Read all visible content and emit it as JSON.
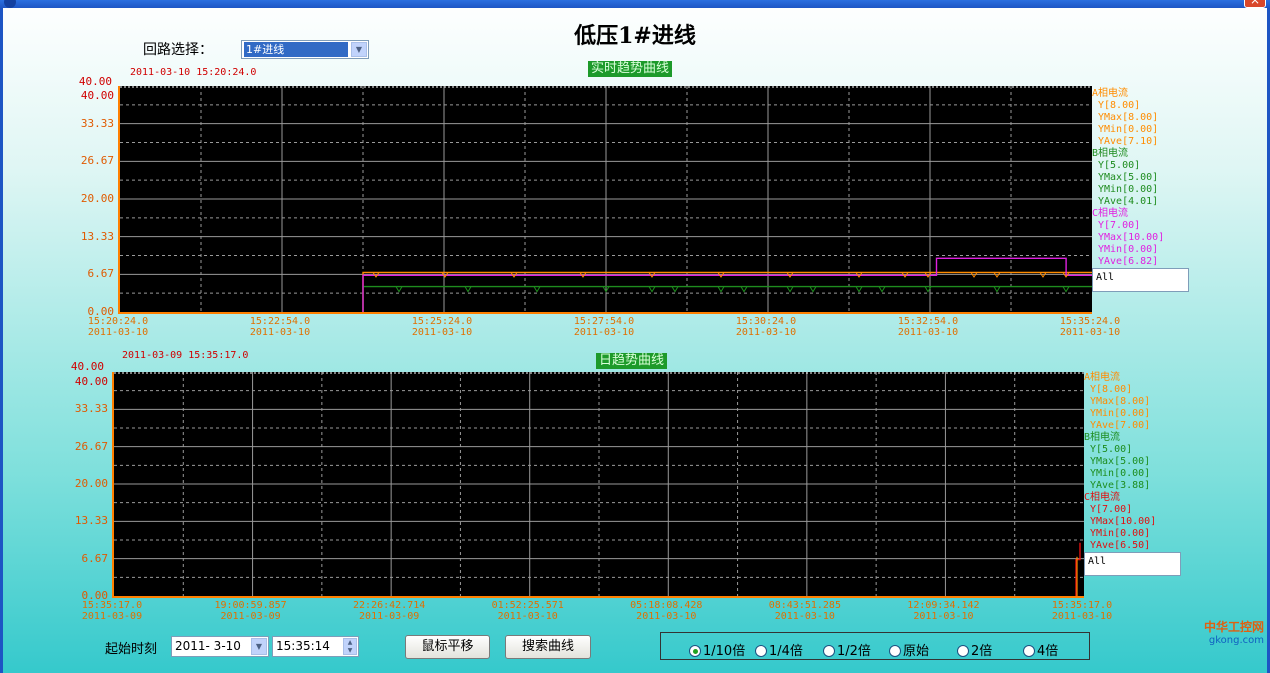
{
  "window": {
    "title_icon": "app-icon",
    "close": "×"
  },
  "page_title": "低压1#进线",
  "loop": {
    "label": "回路选择：",
    "selected": "1#进线"
  },
  "chart1": {
    "title": "实时趋势曲线",
    "timestamp": "2011-03-10 15:20:24.0",
    "y_top": "40.00",
    "y_ticks": [
      "40.00",
      "33.33",
      "26.67",
      "20.00",
      "13.33",
      "6.67",
      "0.00"
    ],
    "x_ticks": [
      {
        "t": "15:20:24.0",
        "d": "2011-03-10"
      },
      {
        "t": "15:22:54.0",
        "d": "2011-03-10"
      },
      {
        "t": "15:25:24.0",
        "d": "2011-03-10"
      },
      {
        "t": "15:27:54.0",
        "d": "2011-03-10"
      },
      {
        "t": "15:30:24.0",
        "d": "2011-03-10"
      },
      {
        "t": "15:32:54.0",
        "d": "2011-03-10"
      },
      {
        "t": "15:35:24.0",
        "d": "2011-03-10"
      }
    ],
    "legend": [
      {
        "name": "A相电流",
        "color": "#ff8c00",
        "lines": [
          "Y[8.00]",
          "YMax[8.00]",
          "YMin[0.00]",
          "YAve[7.10]"
        ]
      },
      {
        "name": "B相电流",
        "color": "#1e8c1e",
        "lines": [
          "Y[5.00]",
          "YMax[5.00]",
          "YMin[0.00]",
          "YAve[4.01]"
        ]
      },
      {
        "name": "C相电流",
        "color": "#e020e0",
        "lines": [
          "Y[7.00]",
          "YMax[10.00]",
          "YMin[0.00]",
          "YAve[6.82]"
        ]
      }
    ],
    "all_label": "All"
  },
  "chart2": {
    "title": "日趋势曲线",
    "timestamp": "2011-03-09 15:35:17.0",
    "y_top": "40.00",
    "y_ticks": [
      "40.00",
      "33.33",
      "26.67",
      "20.00",
      "13.33",
      "6.67",
      "0.00"
    ],
    "x_ticks": [
      {
        "t": "15:35:17.0",
        "d": "2011-03-09"
      },
      {
        "t": "19:00:59.857",
        "d": "2011-03-09"
      },
      {
        "t": "22:26:42.714",
        "d": "2011-03-09"
      },
      {
        "t": "01:52:25.571",
        "d": "2011-03-10"
      },
      {
        "t": "05:18:08.428",
        "d": "2011-03-10"
      },
      {
        "t": "08:43:51.285",
        "d": "2011-03-10"
      },
      {
        "t": "12:09:34.142",
        "d": "2011-03-10"
      },
      {
        "t": "15:35:17.0",
        "d": "2011-03-10"
      }
    ],
    "legend": [
      {
        "name": "A相电流",
        "color": "#ff8c00",
        "lines": [
          "Y[8.00]",
          "YMax[8.00]",
          "YMin[0.00]",
          "YAve[7.00]"
        ]
      },
      {
        "name": "B相电流",
        "color": "#1e8c1e",
        "lines": [
          "Y[5.00]",
          "YMax[5.00]",
          "YMin[0.00]",
          "YAve[3.88]"
        ]
      },
      {
        "name": "C相电流",
        "color": "#e01010",
        "lines": [
          "Y[7.00]",
          "YMax[10.00]",
          "YMin[0.00]",
          "YAve[6.50]"
        ]
      }
    ],
    "all_label": "All"
  },
  "controls": {
    "start_label": "起始时刻",
    "date_value": "2011- 3-10",
    "time_value": "15:35:14",
    "pan_button": "鼠标平移",
    "search_button": "搜索曲线",
    "zoom_options": [
      "1/10倍",
      "1/4倍",
      "1/2倍",
      "原始",
      "2倍",
      "4倍"
    ],
    "zoom_selected": "1/10倍"
  },
  "watermark": {
    "text": "中华工控网",
    "sub": "gkong.com"
  },
  "chart_data": [
    {
      "type": "line",
      "title": "实时趋势曲线",
      "ylim": [
        0,
        40
      ],
      "xlim": [
        "15:20:24.0",
        "15:35:24.0"
      ],
      "series": [
        {
          "name": "A相电流",
          "color": "#ff8c00",
          "values_note": "starts ~15:24:09 at 7.0, fluctuates 6.67-7.0, ends at 7.0",
          "points": [
            [
              "15:24:09",
              0
            ],
            [
              "15:24:09",
              7
            ],
            [
              "15:35:24",
              7
            ]
          ]
        },
        {
          "name": "B相电流",
          "color": "#1e8c1e",
          "points": [
            [
              "15:24:09",
              0
            ],
            [
              "15:24:09",
              4.5
            ],
            [
              "15:35:24",
              4.5
            ]
          ]
        },
        {
          "name": "C相电流",
          "color": "#e020e0",
          "points": [
            [
              "15:24:09",
              0
            ],
            [
              "15:24:09",
              6.5
            ],
            [
              "15:33:00",
              6.5
            ],
            [
              "15:33:00",
              9.5
            ],
            [
              "15:35:00",
              9.5
            ],
            [
              "15:35:00",
              6.5
            ],
            [
              "15:35:24",
              6.5
            ]
          ]
        }
      ]
    },
    {
      "type": "line",
      "title": "日趋势曲线",
      "ylim": [
        0,
        40
      ],
      "series": [
        {
          "name": "A相电流",
          "color": "#ff8c00",
          "points": []
        },
        {
          "name": "B相电流",
          "color": "#1e8c1e",
          "points": []
        },
        {
          "name": "C相电流",
          "color": "#e01010",
          "points": []
        }
      ]
    }
  ]
}
